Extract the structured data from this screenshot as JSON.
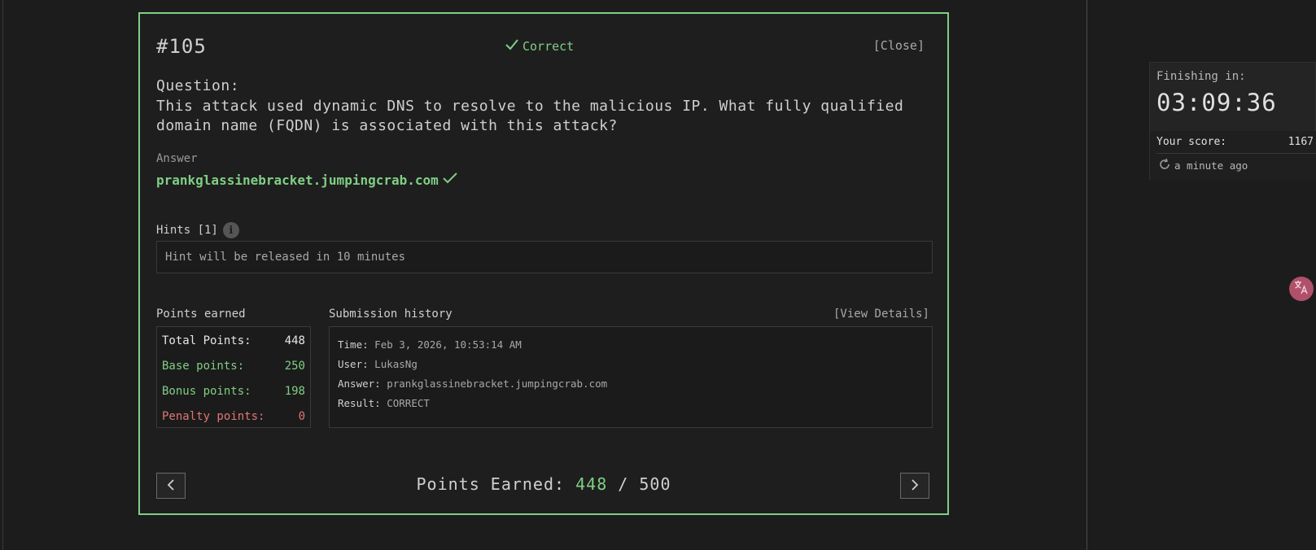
{
  "modal": {
    "ticket": "#105",
    "status": "Correct",
    "close_label": "[Close]",
    "question_label": "Question:",
    "question_text": "This attack used dynamic DNS to resolve to the malicious IP. What fully qualified domain name (FQDN) is associated with this attack?",
    "answer_label": "Answer",
    "answer_value": "prankglassinebracket.jumpingcrab.com",
    "hints_label": "Hints [1]",
    "hint_text": "Hint will be released in 10 minutes",
    "points_label": "Points earned",
    "points": {
      "total_label": "Total Points:",
      "total_value": "448",
      "base_label": "Base points:",
      "base_value": "250",
      "bonus_label": "Bonus points:",
      "bonus_value": "198",
      "penalty_label": "Penalty points:",
      "penalty_value": "0"
    },
    "submission_label": "Submission history",
    "view_details_label": "[View Details]",
    "submission": {
      "time_key": "Time:",
      "time_value": "Feb 3, 2026, 10:53:14 AM",
      "user_key": "User:",
      "user_value": "LukasNg",
      "answer_key": "Answer:",
      "answer_value": "prankglassinebracket.jumpingcrab.com",
      "result_key": "Result:",
      "result_value": "CORRECT"
    },
    "footer": {
      "prefix": "Points Earned:",
      "earned": "448",
      "separator": "/",
      "max": "500"
    }
  },
  "side_panel": {
    "finishing_label": "Finishing in:",
    "timer": "03:09:36",
    "score_label": "Your score:",
    "score_value": "1167",
    "updated_text": "a minute ago"
  },
  "colors": {
    "accent_green": "#7fcf85",
    "penalty_red": "#e07575",
    "background": "#1c1c1c"
  },
  "icons": {
    "status": "check-icon",
    "answer": "check-icon",
    "hints": "info-icon",
    "prev": "chevron-left-icon",
    "next": "chevron-right-icon",
    "refresh": "refresh-icon",
    "translate": "translate-icon"
  }
}
